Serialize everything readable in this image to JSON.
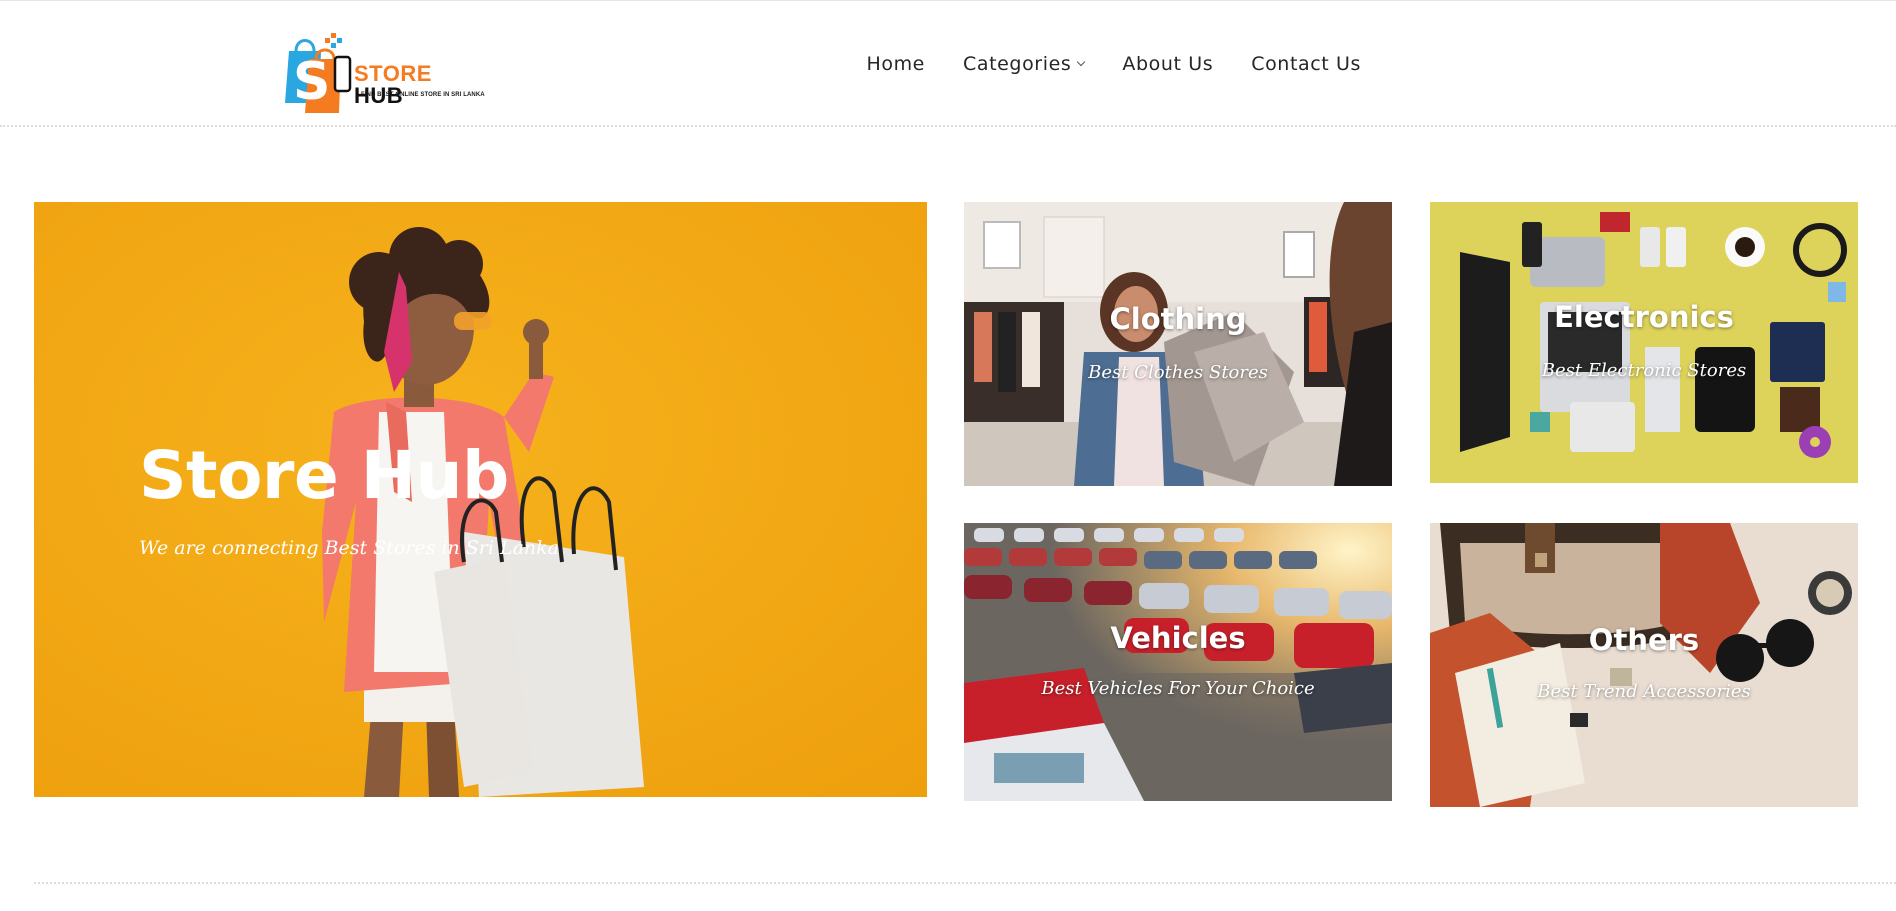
{
  "brand": {
    "word1": "STORE",
    "word2": "HUB",
    "tagline": "FIND BEST ONLINE STORE IN SRI LANKA",
    "colors": {
      "orange": "#f47b20",
      "blue": "#2aa6e0",
      "dark": "#111111"
    }
  },
  "nav": {
    "home": "Home",
    "categories": "Categories",
    "about": "About Us",
    "contact": "Contact Us"
  },
  "hero": {
    "title": "Store Hub",
    "subtitle": "We are connecting Best Stores in Sri Lanka",
    "bg_color": "#f2a713"
  },
  "categories": [
    {
      "title": "Clothing",
      "subtitle": "Best Clothes Stores"
    },
    {
      "title": "Electronics",
      "subtitle": "Best Electronic Stores"
    },
    {
      "title": "Vehicles",
      "subtitle": "Best Vehicles For Your Choice"
    },
    {
      "title": "Others",
      "subtitle": "Best Trend Accessories"
    }
  ]
}
